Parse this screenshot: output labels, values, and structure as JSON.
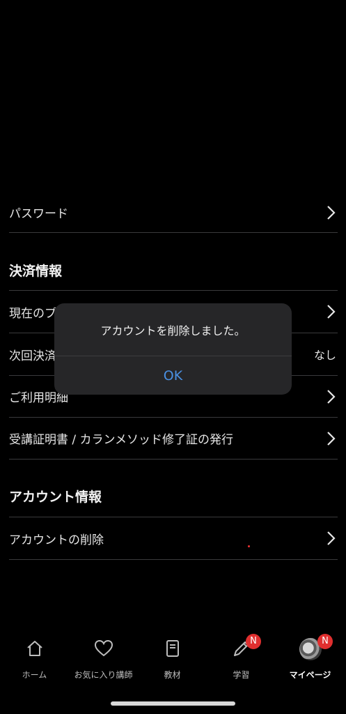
{
  "settings": {
    "password_label": "パスワード",
    "payment_section_title": "決済情報",
    "current_plan_label": "現在のプ",
    "next_payment_label": "次回決済",
    "next_payment_value": "なし",
    "usage_details_label": "ご利用明細",
    "certificate_label": "受講証明書 / カランメソッド修了証の発行",
    "account_section_title": "アカウント情報",
    "delete_account_label": "アカウントの削除"
  },
  "dialog": {
    "message": "アカウントを削除しました。",
    "ok_label": "OK"
  },
  "tabbar": {
    "items": [
      {
        "label": "ホーム",
        "icon": "home-icon"
      },
      {
        "label": "お気に入り講師",
        "icon": "heart-icon"
      },
      {
        "label": "教材",
        "icon": "book-icon"
      },
      {
        "label": "学習",
        "icon": "pencil-icon",
        "badge": "N"
      },
      {
        "label": "マイページ",
        "icon": "avatar",
        "badge": "N"
      }
    ]
  },
  "colors": {
    "background": "#000000",
    "accent": "#4a90e2",
    "badge": "#e02f2f"
  }
}
